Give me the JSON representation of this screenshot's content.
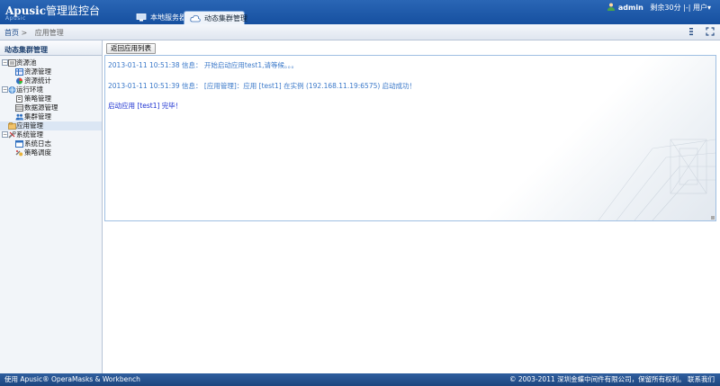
{
  "header": {
    "brand": "Apusic",
    "title": "管理监控台",
    "subtitle": "Apusic",
    "tabs": [
      {
        "label": "本地服务器"
      },
      {
        "label": "动态集群管理"
      }
    ],
    "user": "admin",
    "session": "剩余30分",
    "separator": "|-|",
    "user_menu": "用户▾"
  },
  "breadcrumb": {
    "home": "首页",
    "sep": ">",
    "current": "应用管理"
  },
  "sidebar": {
    "title": "动态集群管理",
    "items": [
      {
        "label": "资源池",
        "level": 0,
        "toggle": "−"
      },
      {
        "label": "资源管理",
        "level": 1
      },
      {
        "label": "资源统计",
        "level": 1
      },
      {
        "label": "运行环境",
        "level": 0,
        "toggle": "−"
      },
      {
        "label": "策略管理",
        "level": 1
      },
      {
        "label": "数据源管理",
        "level": 1
      },
      {
        "label": "集群管理",
        "level": 1
      },
      {
        "label": "应用管理",
        "level": 0,
        "selected": true
      },
      {
        "label": "系统管理",
        "level": 0,
        "toggle": "−"
      },
      {
        "label": "系统日志",
        "level": 1
      },
      {
        "label": "策略调度",
        "level": 1
      }
    ]
  },
  "main": {
    "back_button": "返回应用列表",
    "log": [
      {
        "text": "2013-01-11 10:51:38 信息： 开始启动应用test1,请等候。。。",
        "kind": "info"
      },
      {
        "text": "2013-01-11 10:51:39 信息： [应用管理]：应用 [test1] 在实例 (192.168.11.19:6575) 启动成功！",
        "kind": "info"
      },
      {
        "text": "启动应用 [test1] 完毕！",
        "kind": "done"
      }
    ]
  },
  "footer": {
    "left": "使用 Apusic® OperaMasks & Workbench",
    "right": "© 2003-2011 深圳金蝶中间件有限公司，保留所有权利。 联系我们"
  },
  "colors": {
    "header_blue": "#1f5aa8",
    "log_info": "#3a78c9",
    "log_done": "#1a2fd0"
  }
}
